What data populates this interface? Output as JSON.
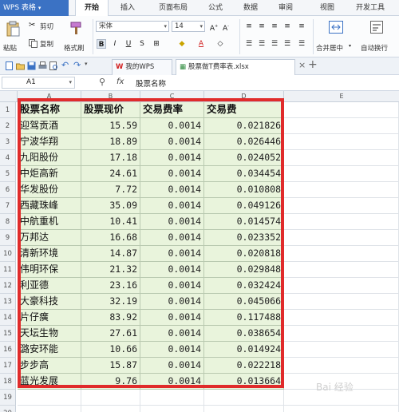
{
  "app": {
    "title": "WPS 表格"
  },
  "menu": [
    "开始",
    "插入",
    "页面布局",
    "公式",
    "数据",
    "审阅",
    "视图",
    "开发工具"
  ],
  "ribbon": {
    "cut": "剪切",
    "paste": "粘贴",
    "copy": "复制",
    "format_painter": "格式刷",
    "font_name": "宋体",
    "font_size": "14",
    "bold": "B",
    "italic": "I",
    "underline": "U",
    "merge": "合并居中",
    "wrap": "自动换行"
  },
  "tabs": [
    "我的WPS",
    "股票做T费率表.xlsx"
  ],
  "formula_bar": {
    "cell_ref": "A1",
    "fx": "fx",
    "content": "股票名称"
  },
  "columns": [
    "A",
    "B",
    "C",
    "D",
    "E"
  ],
  "table": {
    "headers": [
      "股票名称",
      "股票现价",
      "交易费率",
      "交易费"
    ],
    "rows": [
      [
        "迎驾贡酒",
        "15.59",
        "0.0014",
        "0.021826"
      ],
      [
        "宁波华翔",
        "18.89",
        "0.0014",
        "0.026446"
      ],
      [
        "九阳股份",
        "17.18",
        "0.0014",
        "0.024052"
      ],
      [
        "中炬高新",
        "24.61",
        "0.0014",
        "0.034454"
      ],
      [
        "华发股份",
        "7.72",
        "0.0014",
        "0.010808"
      ],
      [
        "西藏珠峰",
        "35.09",
        "0.0014",
        "0.049126"
      ],
      [
        "中航重机",
        "10.41",
        "0.0014",
        "0.014574"
      ],
      [
        "万邦达",
        "16.68",
        "0.0014",
        "0.023352"
      ],
      [
        "清新环境",
        "14.87",
        "0.0014",
        "0.020818"
      ],
      [
        "伟明环保",
        "21.32",
        "0.0014",
        "0.029848"
      ],
      [
        "利亚德",
        "23.16",
        "0.0014",
        "0.032424"
      ],
      [
        "大豪科技",
        "32.19",
        "0.0014",
        "0.045066"
      ],
      [
        "片仔癀",
        "83.92",
        "0.0014",
        "0.117488"
      ],
      [
        "天坛生物",
        "27.61",
        "0.0014",
        "0.038654"
      ],
      [
        "潞安环能",
        "10.66",
        "0.0014",
        "0.014924"
      ],
      [
        "步步高",
        "15.87",
        "0.0014",
        "0.022218"
      ],
      [
        "蓝光发展",
        "9.76",
        "0.0014",
        "0.013664"
      ]
    ]
  },
  "row_numbers": [
    "1",
    "2",
    "3",
    "4",
    "5",
    "6",
    "7",
    "8",
    "9",
    "10",
    "11",
    "12",
    "13",
    "14",
    "15",
    "16",
    "17",
    "18",
    "19",
    "20"
  ],
  "watermark": "Bai 经验",
  "colors": {
    "accent": "#3b72c4",
    "highlight": "#e02b2b",
    "cell_fill": "#e9f4dc"
  }
}
